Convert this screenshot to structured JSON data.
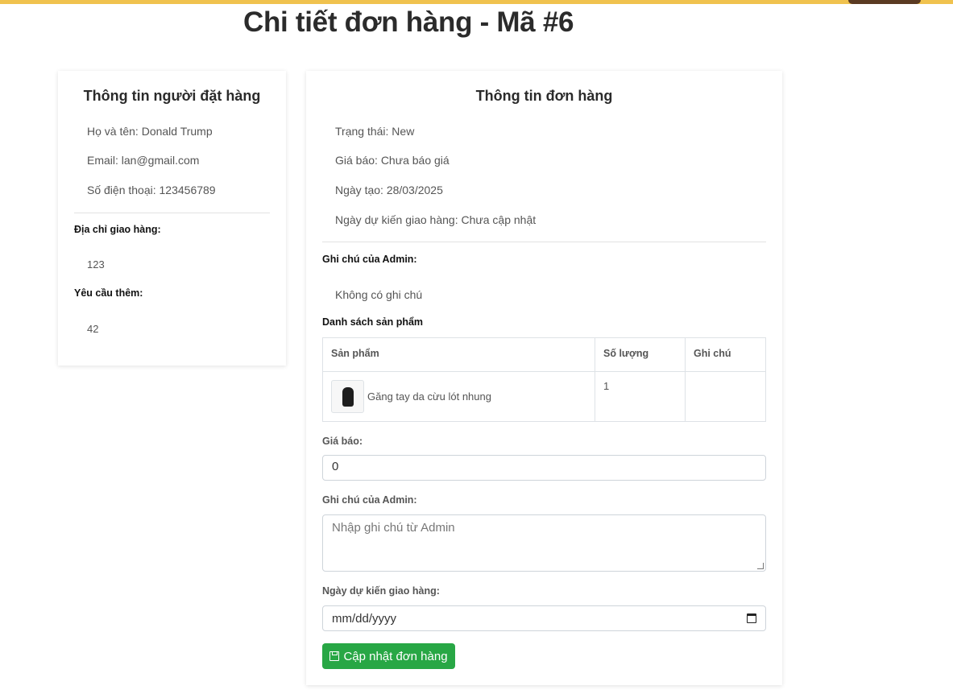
{
  "page_title": "Chi tiết đơn hàng - Mã #6",
  "customer": {
    "heading": "Thông tin người đặt hàng",
    "name_line": "Họ và tên: Donald Trump",
    "email_line": "Email: lan@gmail.com",
    "phone_line": "Số điện thoại: 123456789",
    "address_label": "Địa chỉ giao hàng:",
    "address_value": "123",
    "extra_label": "Yêu cầu thêm:",
    "extra_value": "42"
  },
  "order": {
    "heading": "Thông tin đơn hàng",
    "status_line": "Trạng thái: New",
    "price_line": "Giá báo: Chưa báo giá",
    "created_line": "Ngày tạo: 28/03/2025",
    "delivery_line": "Ngày dự kiến giao hàng: Chưa cập nhật",
    "admin_note_label": "Ghi chú của Admin:",
    "admin_note_value": "Không có ghi chú",
    "products_label": "Danh sách sản phẩm",
    "table": {
      "headers": [
        "Sản phẩm",
        "Số lượng",
        "Ghi chú"
      ],
      "rows": [
        {
          "product": "Găng tay da cừu lót nhung",
          "quantity": "1",
          "note": ""
        }
      ]
    }
  },
  "form": {
    "price_label": "Giá báo:",
    "price_value": "0",
    "note_label": "Ghi chú của Admin:",
    "note_placeholder": "Nhập ghi chú từ Admin",
    "date_label": "Ngày dự kiến giao hàng:",
    "date_placeholder": "mm/dd/yyyy",
    "submit_label": "Cập nhật đơn hàng"
  },
  "colors": {
    "accent_green": "#28a745",
    "top_strip": "#f0c24e"
  }
}
